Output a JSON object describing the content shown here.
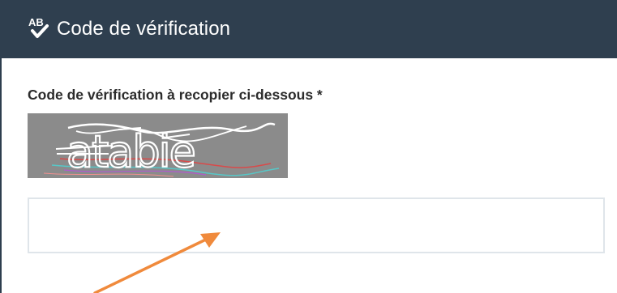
{
  "header": {
    "icon": "spellcheck-ab-icon",
    "title": "Code de vérification",
    "background_color": "#2f3f4f"
  },
  "form": {
    "label": "Code de vérification à recopier ci-dessous *",
    "captcha_text": "atabie",
    "input_value": "",
    "input_placeholder": ""
  },
  "annotation": {
    "icon": "arrow-icon",
    "color": "#f08a3c"
  }
}
